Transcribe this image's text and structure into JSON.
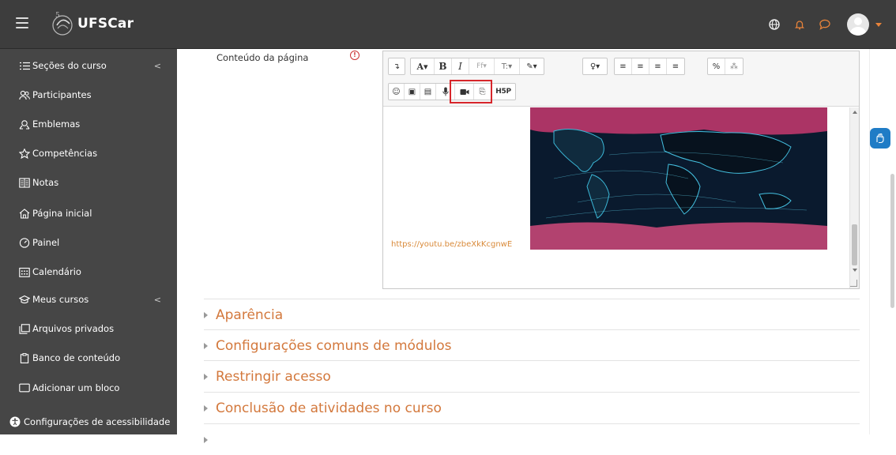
{
  "brand": {
    "name": "UFSCar"
  },
  "colors": {
    "topbar": "#3d3d3d",
    "sidebar": "#464646",
    "accent": "#d3783c",
    "highlight": "#d7262b",
    "notify": "#e8833a"
  },
  "sidebar": {
    "items": [
      {
        "label": "Seções do curso",
        "icon": "list-icon",
        "chevron": "<"
      },
      {
        "label": "Participantes",
        "icon": "people-icon"
      },
      {
        "label": "Emblemas",
        "icon": "badge-icon"
      },
      {
        "label": "Competências",
        "icon": "star-icon"
      },
      {
        "label": "Notas",
        "icon": "gradebook-icon"
      },
      {
        "label": "Página inicial",
        "icon": "home-icon"
      },
      {
        "label": "Painel",
        "icon": "dashboard-icon"
      },
      {
        "label": "Calendário",
        "icon": "calendar-icon"
      },
      {
        "label": "Meus cursos",
        "icon": "graduation-cap-icon",
        "chevron": "<"
      },
      {
        "label": "Arquivos privados",
        "icon": "files-icon"
      },
      {
        "label": "Banco de conteúdo",
        "icon": "clipboard-icon"
      },
      {
        "label": "Adicionar um bloco",
        "icon": "block-icon"
      },
      {
        "label": "Configurações de acessibilidade",
        "icon": "accessibility-icon"
      }
    ]
  },
  "main": {
    "field_label": "Conteúdo da página",
    "editor": {
      "toolbar": {
        "row1": [
          "↴",
          "A▾",
          "B",
          "I",
          "Ff▾",
          "T:▾",
          "✎▾",
          "♀▾",
          "≡",
          "≡",
          "≡",
          "≡",
          "%",
          "⁂"
        ],
        "row2": [
          "☺",
          "▣",
          "▤",
          "mic",
          "cam",
          "⎘",
          "H5P"
        ]
      },
      "link": "https://youtu.be/zbeXkKcgnwE"
    },
    "sections": [
      "Aparência",
      "Configurações comuns de módulos",
      "Restringir acesso",
      "Conclusão de atividades no curso"
    ]
  }
}
